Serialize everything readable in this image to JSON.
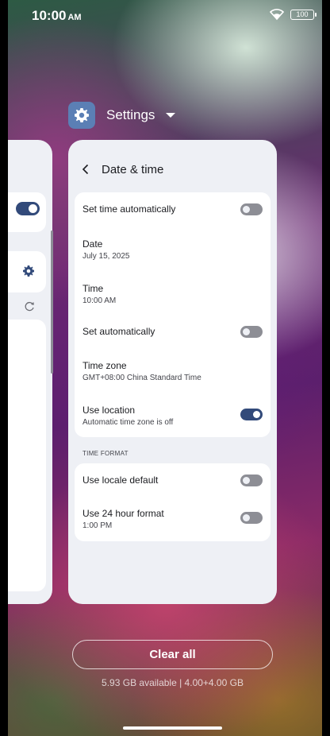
{
  "status_bar": {
    "time": "10:00",
    "ampm": "AM",
    "battery": "100"
  },
  "app": {
    "name": "Settings",
    "icon": "settings-gear-icon"
  },
  "screen": {
    "title": "Date & time",
    "rows": [
      {
        "title": "Set time automatically",
        "subtitle": "",
        "toggle": "off"
      },
      {
        "title": "Date",
        "subtitle": "July 15, 2025"
      },
      {
        "title": "Time",
        "subtitle": "10:00 AM"
      },
      {
        "title": "Set automatically",
        "subtitle": "",
        "toggle": "off"
      },
      {
        "title": "Time zone",
        "subtitle": "GMT+08:00 China Standard Time"
      },
      {
        "title": "Use location",
        "subtitle": "Automatic time zone is off",
        "toggle": "on"
      }
    ],
    "section_header": "TIME FORMAT",
    "format_rows": [
      {
        "title": "Use locale default",
        "subtitle": "",
        "toggle": "off"
      },
      {
        "title": "Use 24 hour format",
        "subtitle": "1:00 PM",
        "toggle": "off"
      }
    ]
  },
  "recents": {
    "clear_all": "Clear all",
    "memory": "5.93 GB available | 4.00+4.00 GB"
  },
  "colors": {
    "toggle_on": "#324a7a",
    "toggle_off": "#8d8e95",
    "card_bg": "#eef0f5"
  }
}
